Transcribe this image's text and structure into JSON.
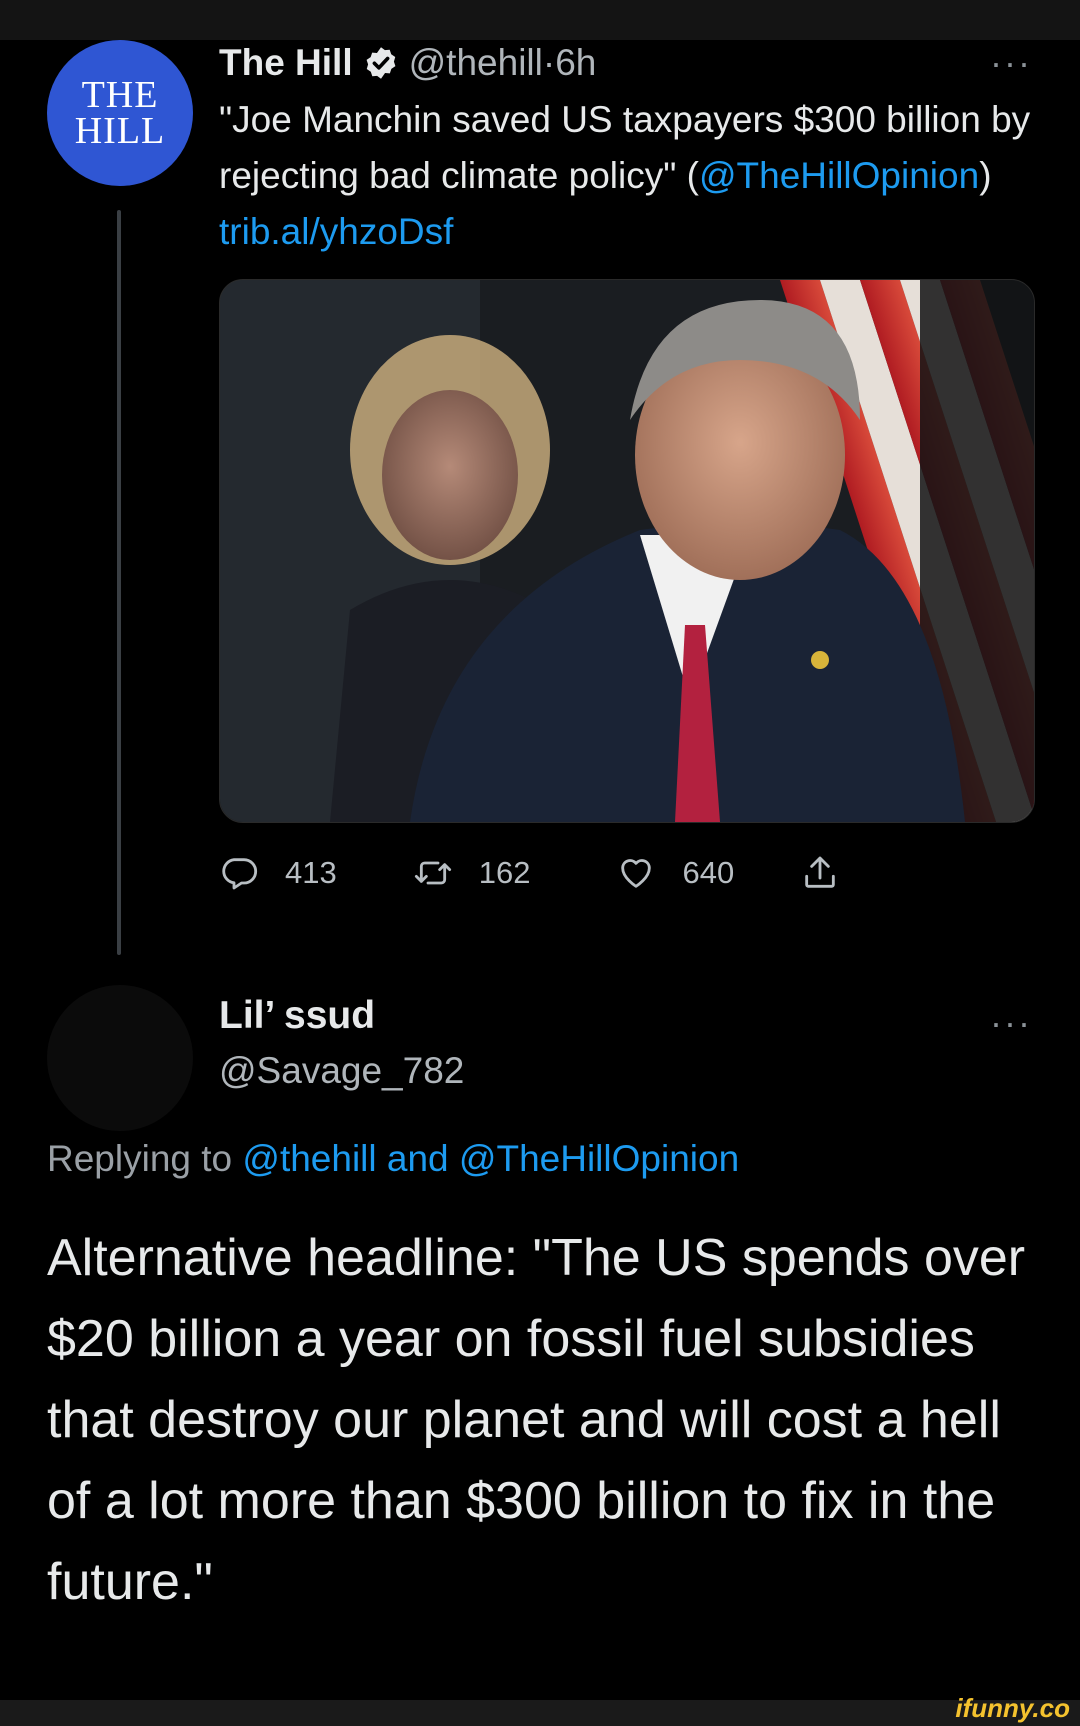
{
  "tweet1": {
    "avatar_text_line1": "THE",
    "avatar_text_line2": "HILL",
    "name": "The Hill",
    "handle": "@thehill",
    "separator": " · ",
    "time": "6h",
    "more": "···",
    "text_main": "\"Joe Manchin saved US taxpayers $300 billion by rejecting bad climate policy\" (",
    "text_mention": "@TheHillOpinion",
    "text_close": ") ",
    "text_link": "trib.al/yhzoDsf",
    "stats": {
      "replies": "413",
      "retweets": "162",
      "likes": "640"
    }
  },
  "tweet2": {
    "name": "Lil’ ssud",
    "handle": "@Savage_782",
    "more": "···",
    "replying_prefix": "Replying to ",
    "replying_user1": "@thehill",
    "replying_and": " and ",
    "replying_user2": "@TheHillOpinion",
    "body": "Alternative headline: \"The US spends over $20 billion a year on fossil fuel subsidies that destroy our planet and will cost a hell of a lot more than $300 billion to fix in the future.\""
  },
  "watermark": "ifunny.co",
  "colors": {
    "background": "#000000",
    "link": "#1d9bf0",
    "hill_blue": "#2f56d3",
    "muted": "#b0b6bb",
    "watermark": "#f4c22e"
  },
  "icons": [
    "verified-badge-icon",
    "reply-icon",
    "retweet-icon",
    "like-icon",
    "share-icon"
  ]
}
